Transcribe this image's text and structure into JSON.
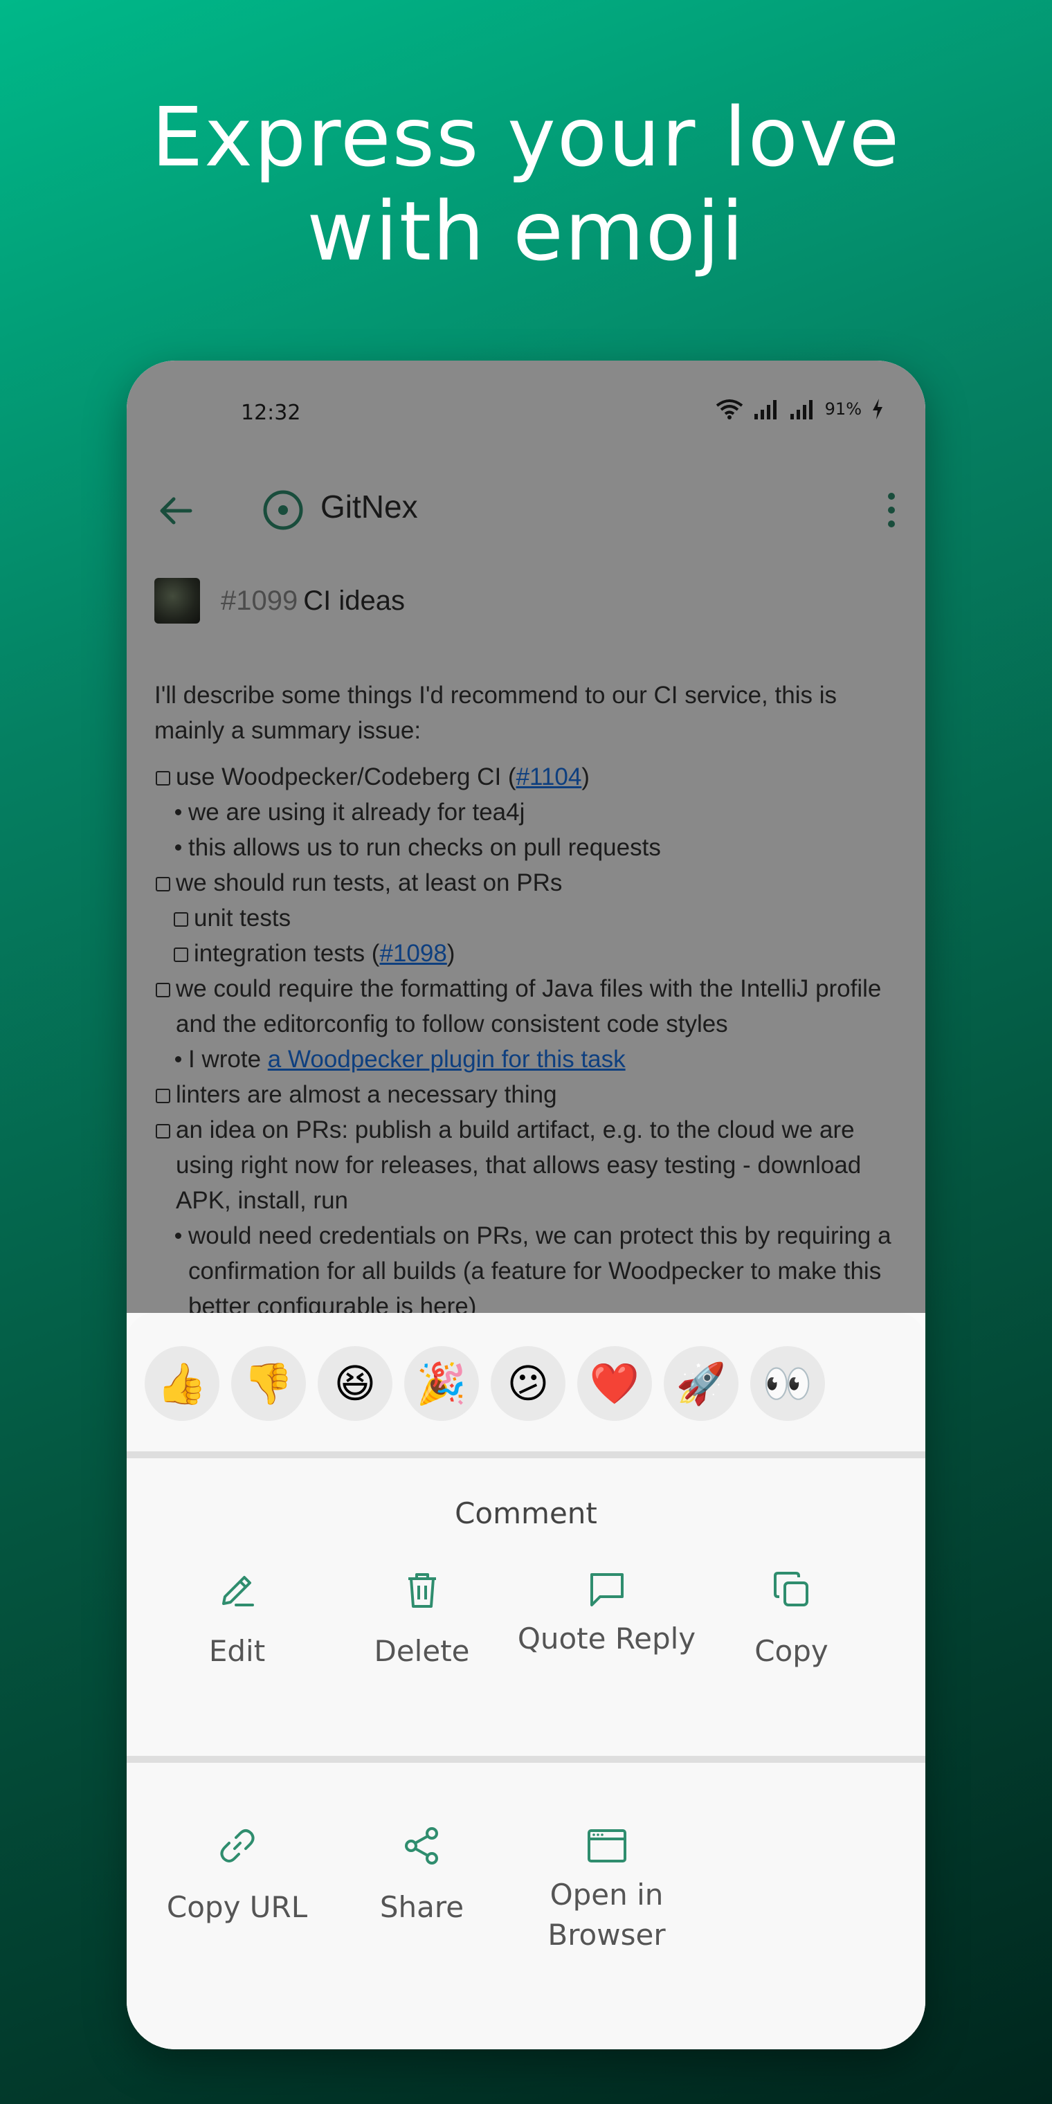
{
  "headline": {
    "line1": "Express your love",
    "line2": "with emoji"
  },
  "status": {
    "time": "12:32",
    "battery": "91%"
  },
  "appbar": {
    "title": "GitNex"
  },
  "issue": {
    "number": "#1099",
    "title": "CI ideas",
    "intro": "I'll describe some things I'd recommend to our CI service, this is mainly a summary issue:",
    "items": {
      "i1": {
        "pre": "use Woodpecker/Codeberg CI (",
        "link": "#1104",
        "post": ")"
      },
      "i1a": "we are using it already for tea4j",
      "i1b": "this allows us to run checks on pull requests",
      "i2": "we should run tests, at least on PRs",
      "i2a": "unit tests",
      "i2b": {
        "pre": "integration tests (",
        "link": "#1098",
        "post": ")"
      },
      "i3": "we could require the formatting of Java files with the IntelliJ profile and the editorconfig to follow consistent code styles",
      "i3a": {
        "pre": "I wrote ",
        "link": "a Woodpecker plugin for this task"
      },
      "i4": "linters are almost a necessary thing",
      "i5": "an idea on PRs: publish a build artifact, e.g. to the cloud we are using right now for releases, that allows easy testing - download APK, install, run",
      "i5a": "would need credentials on PRs, we can protect this by requiring a confirmation for all builds (a feature for Woodpecker to make this better configurable is here)"
    }
  },
  "reactions": [
    "👍",
    "👎",
    "😆",
    "🎉",
    "😕",
    "❤️",
    "🚀",
    "👀"
  ],
  "sheet": {
    "section_title": "Comment",
    "actions_row1": {
      "edit": "Edit",
      "delete": "Delete",
      "quote": "Quote Reply",
      "copy": "Copy"
    },
    "actions_row2": {
      "copy_url": "Copy URL",
      "share": "Share",
      "open_browser": "Open in Browser"
    }
  },
  "colors": {
    "accent": "#2f8d6e",
    "background_top": "#00b889",
    "background_bottom": "#00261d"
  }
}
